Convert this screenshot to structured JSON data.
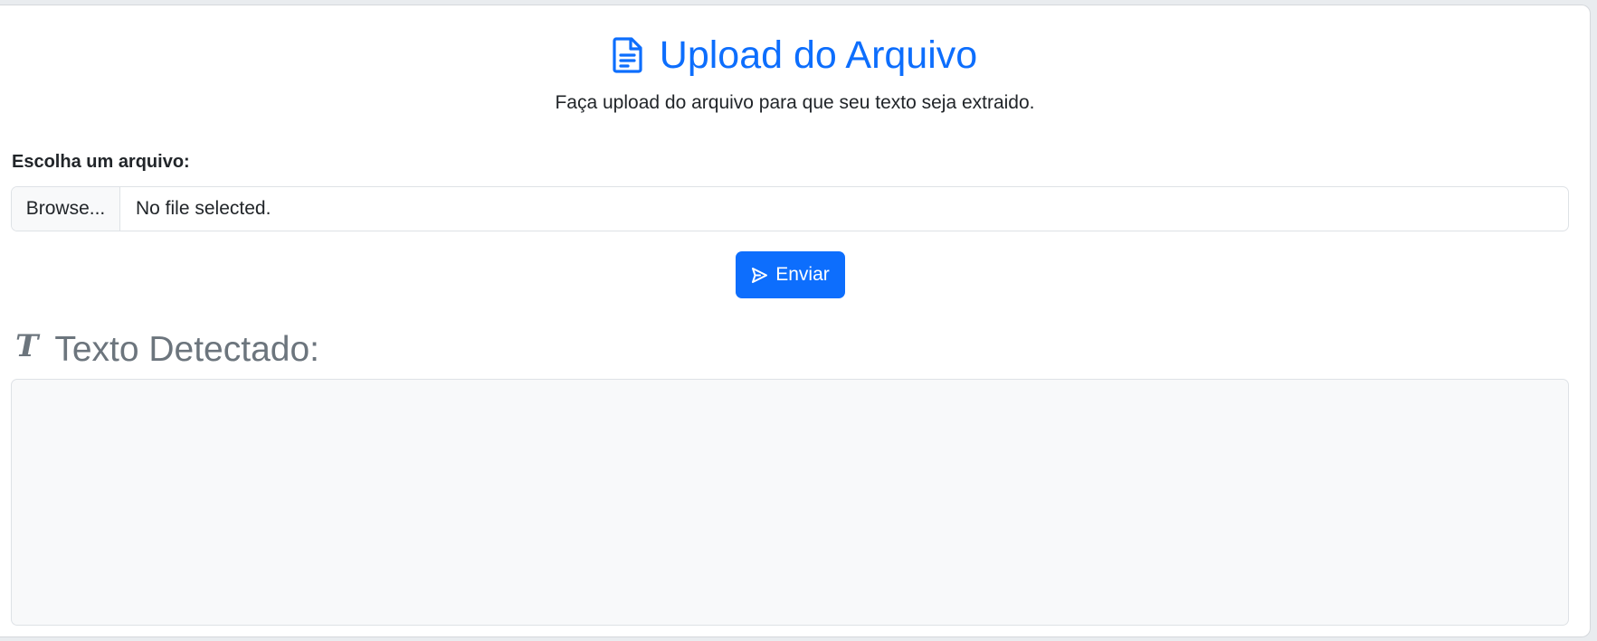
{
  "header": {
    "icon": "file-text-icon",
    "title": "Upload do Arquivo",
    "subtitle": "Faça upload do arquivo para que seu texto seja extraido."
  },
  "upload": {
    "label": "Escolha um arquivo:",
    "browse_label": "Browse...",
    "status": "No file selected."
  },
  "send_button": {
    "icon": "send-icon",
    "label": "Enviar"
  },
  "result": {
    "icon": "text-format-icon",
    "icon_glyph": "T",
    "title": "Texto Detectado:",
    "content": ""
  },
  "colors": {
    "primary": "#0d6efd",
    "muted": "#6c757d",
    "text": "#212529",
    "surface": "#f8f9fa",
    "border": "#dee2e6"
  }
}
